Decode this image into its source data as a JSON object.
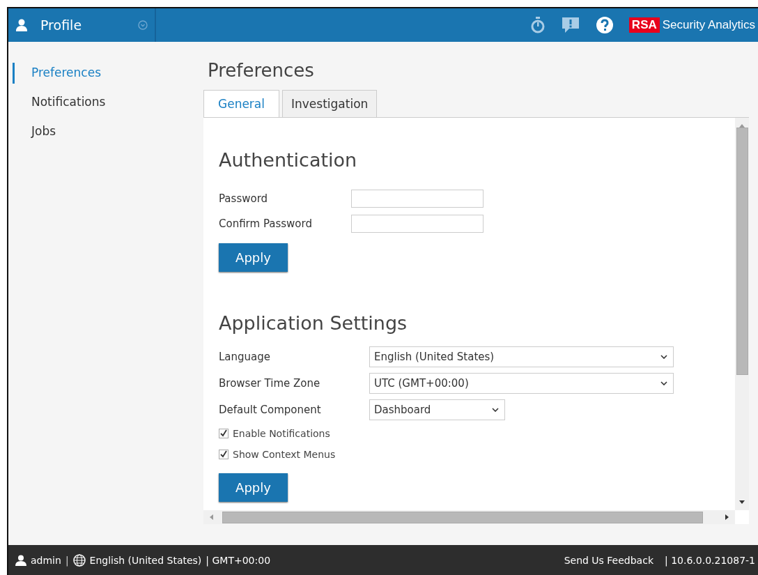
{
  "header": {
    "title": "Profile",
    "brand_mark": "RSA",
    "brand_name": "Security Analytics"
  },
  "sidebar": {
    "items": [
      {
        "label": "Preferences",
        "selected": true
      },
      {
        "label": "Notifications",
        "selected": false
      },
      {
        "label": "Jobs",
        "selected": false
      }
    ]
  },
  "page_title": "Preferences",
  "tabs": [
    {
      "label": "General",
      "selected": true
    },
    {
      "label": "Investigation",
      "selected": false
    }
  ],
  "authentication": {
    "heading": "Authentication",
    "fields": [
      {
        "label": "Password"
      },
      {
        "label": "Confirm Password"
      }
    ],
    "button": "Apply"
  },
  "application_settings": {
    "heading": "Application Settings",
    "selects": [
      {
        "label": "Language",
        "value": "English (United States)",
        "wide": true
      },
      {
        "label": "Browser Time Zone",
        "value": "UTC (GMT+00:00)",
        "wide": true
      },
      {
        "label": "Default Component",
        "value": "Dashboard",
        "wide": false
      }
    ],
    "checkboxes": [
      {
        "label": "Enable Notifications",
        "checked": true
      },
      {
        "label": "Show Context Menus",
        "checked": true
      }
    ],
    "button": "Apply"
  },
  "status_bar": {
    "user": "admin",
    "separator": "|",
    "language": "English (United States)",
    "timezone": "| GMT+00:00",
    "feedback": "Send Us Feedback",
    "version": "| 10.6.0.0.21087-1"
  }
}
